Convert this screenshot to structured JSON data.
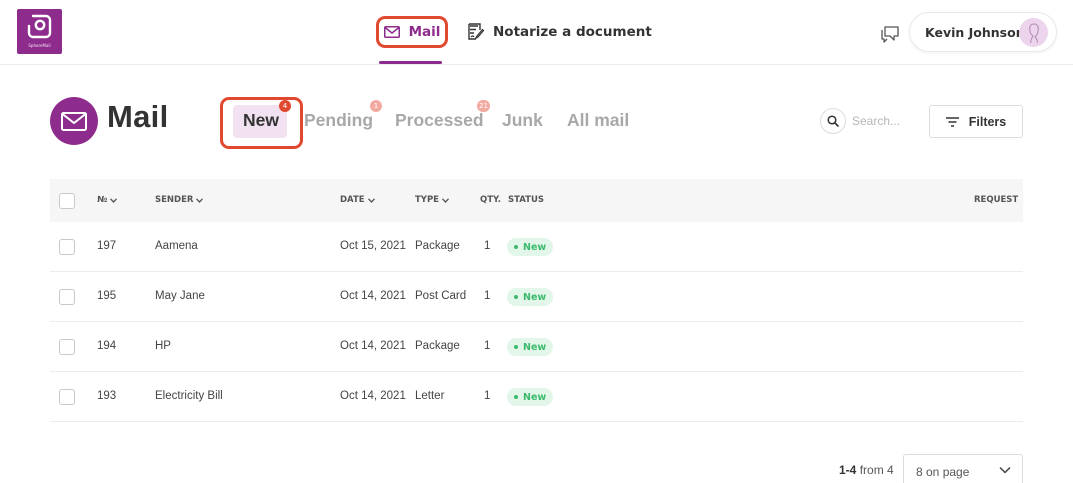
{
  "brand": {
    "logo_text": "SphereMail"
  },
  "nav": {
    "mail_label": "Mail",
    "notarize_label": "Notarize a document"
  },
  "user": {
    "name": "Kevin Johnson"
  },
  "page": {
    "title": "Mail"
  },
  "tabs": [
    {
      "label": "New",
      "badge": "4",
      "active": true
    },
    {
      "label": "Pending",
      "badge": "1"
    },
    {
      "label": "Processed",
      "badge": "21"
    },
    {
      "label": "Junk"
    },
    {
      "label": "All mail"
    }
  ],
  "search": {
    "placeholder": "Search..."
  },
  "filters": {
    "label": "Filters"
  },
  "table": {
    "headers": {
      "number": "№",
      "sender": "SENDER",
      "date": "DATE",
      "type": "TYPE",
      "qty": "QTY.",
      "status": "STATUS",
      "request": "REQUEST"
    },
    "rows": [
      {
        "number": "197",
        "sender": "Aamena",
        "date": "Oct 15, 2021",
        "type": "Package",
        "qty": "1",
        "status": "New"
      },
      {
        "number": "195",
        "sender": "May Jane",
        "date": "Oct 14, 2021",
        "type": "Post Card",
        "qty": "1",
        "status": "New"
      },
      {
        "number": "194",
        "sender": "HP",
        "date": "Oct 14, 2021",
        "type": "Package",
        "qty": "1",
        "status": "New"
      },
      {
        "number": "193",
        "sender": "Electricity Bill",
        "date": "Oct 14, 2021",
        "type": "Letter",
        "qty": "1",
        "status": "New"
      }
    ]
  },
  "pagination": {
    "range": "1-4",
    "from_text": "from 4",
    "per_page": "8 on page"
  },
  "colors": {
    "accent": "#8e2c8e",
    "highlight_outline": "#e0492f",
    "status_new": "#3cba6c"
  }
}
